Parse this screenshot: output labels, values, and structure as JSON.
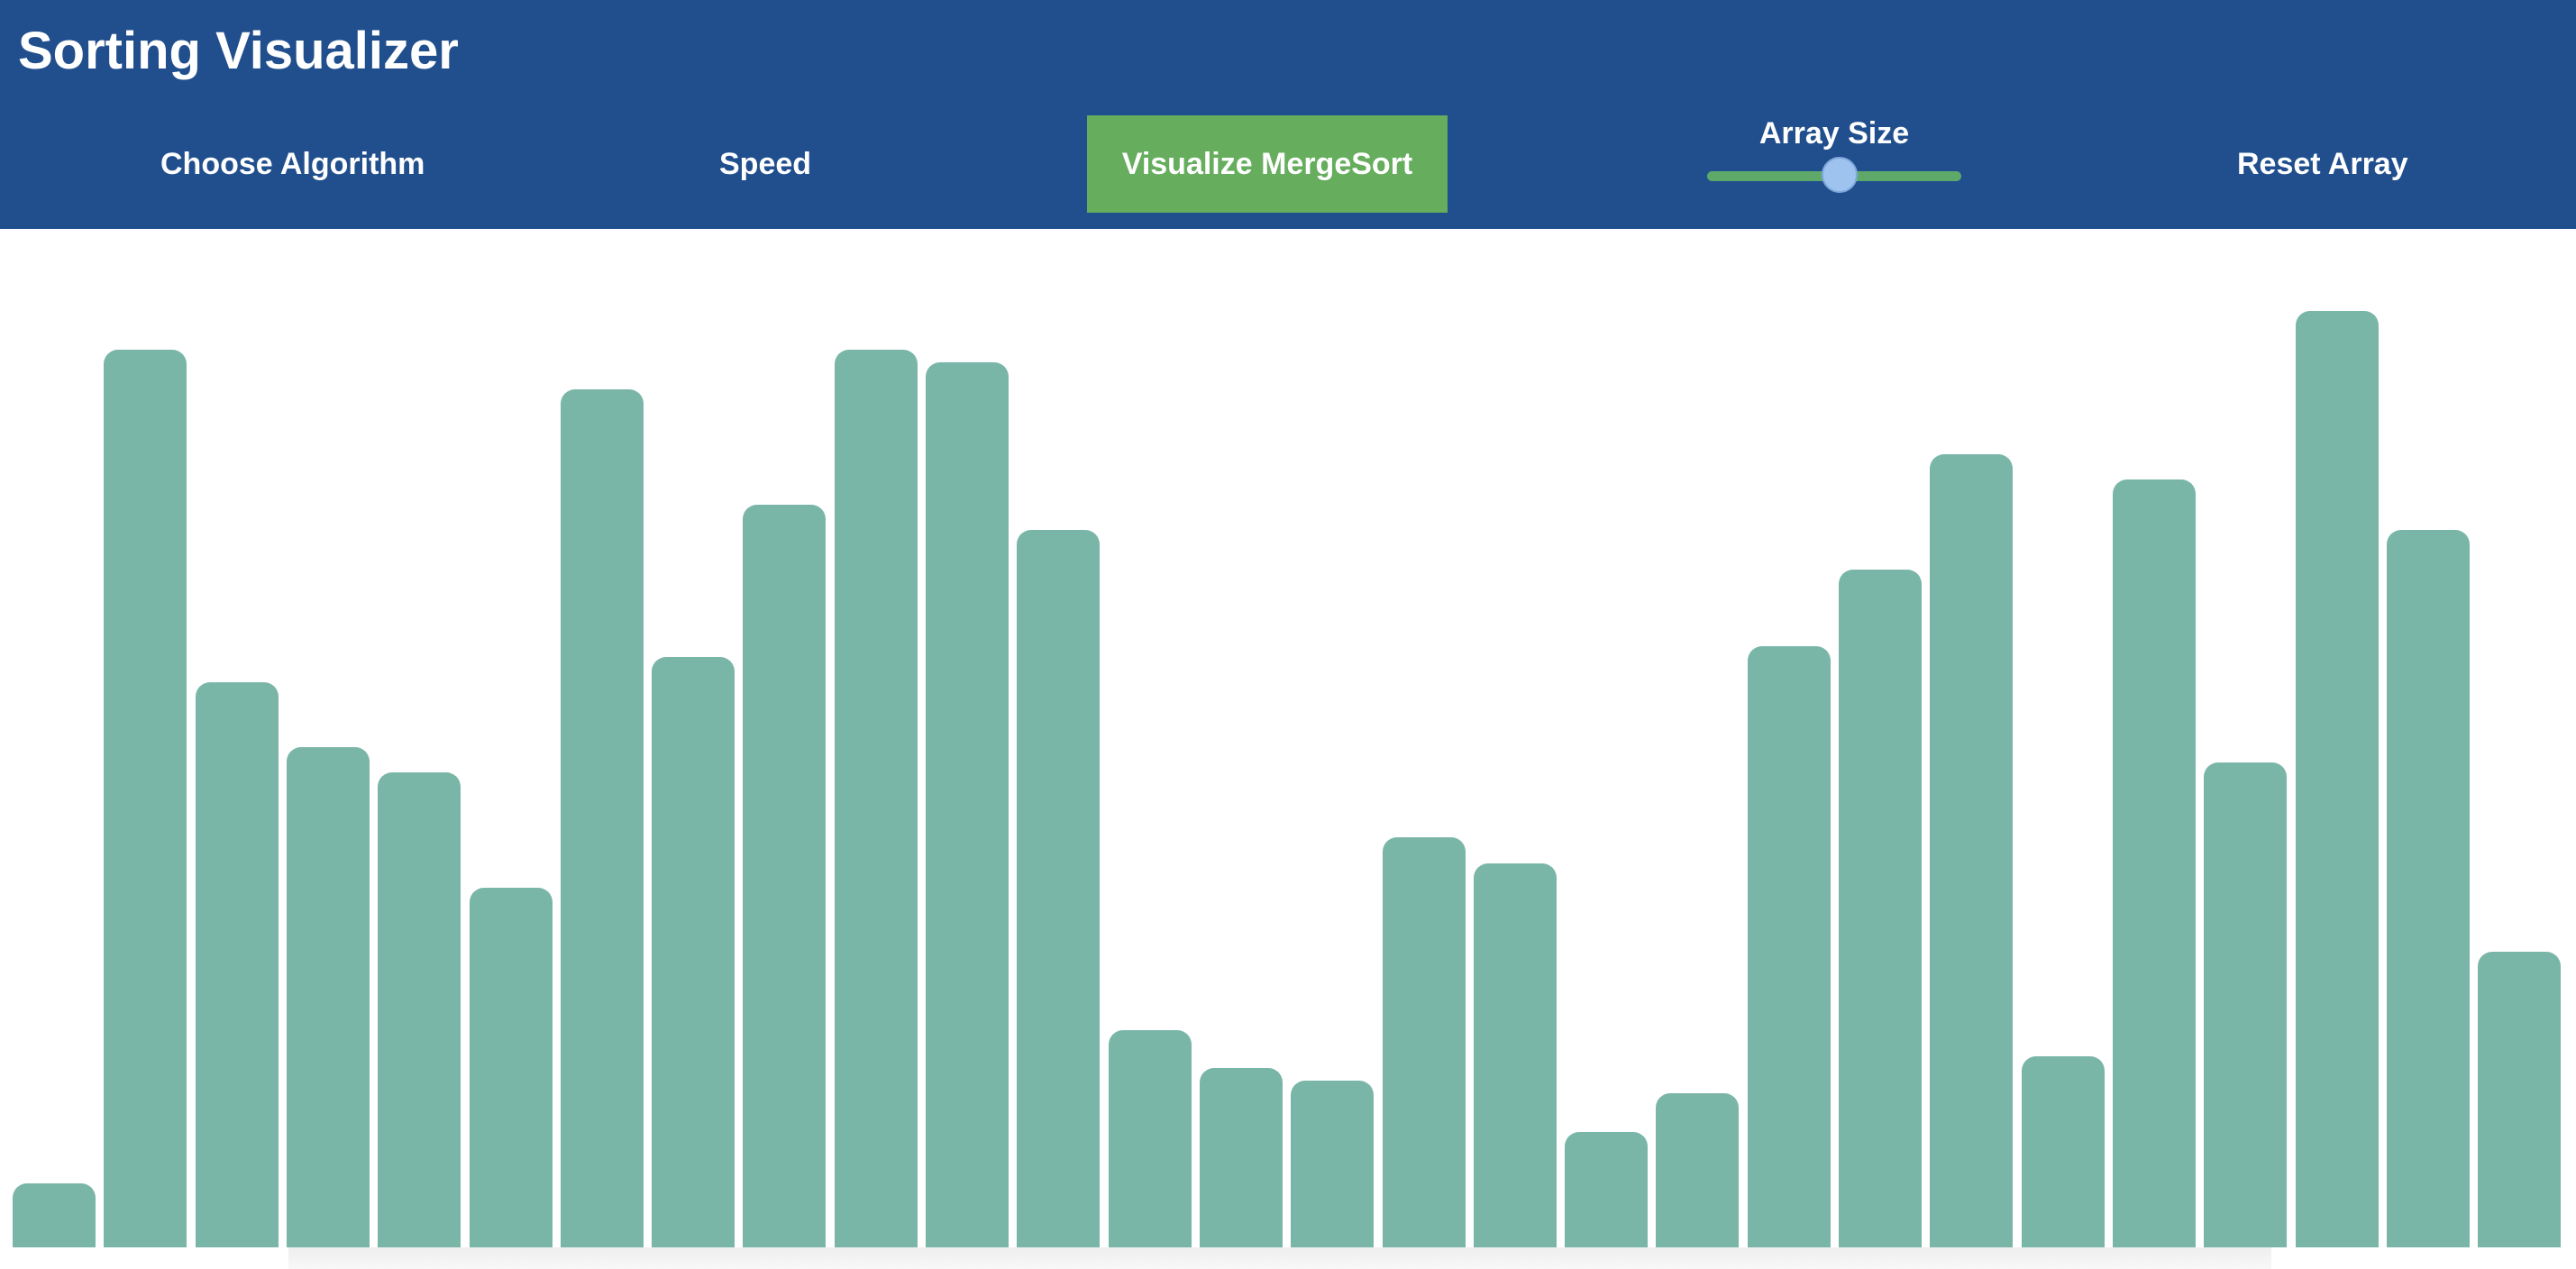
{
  "header": {
    "title": "Sorting Visualizer",
    "choose_algorithm_label": "Choose Algorithm",
    "speed_label": "Speed",
    "visualize_label": "Visualize MergeSort",
    "array_size_label": "Array Size",
    "array_size_fraction": 0.52,
    "reset_label": "Reset Array"
  },
  "colors": {
    "navbar": "#214f8d",
    "visualize_button": "#66ad5e",
    "bar": "#7ab6a8",
    "slider_track": "#5ea96a",
    "slider_thumb": "#9ec3ee"
  },
  "bars": [
    71,
    996,
    627,
    555,
    527,
    399,
    952,
    655,
    824,
    996,
    982,
    796,
    241,
    199,
    185,
    455,
    426,
    128,
    171,
    667,
    752,
    880,
    212,
    852,
    538,
    1039,
    796,
    328
  ]
}
